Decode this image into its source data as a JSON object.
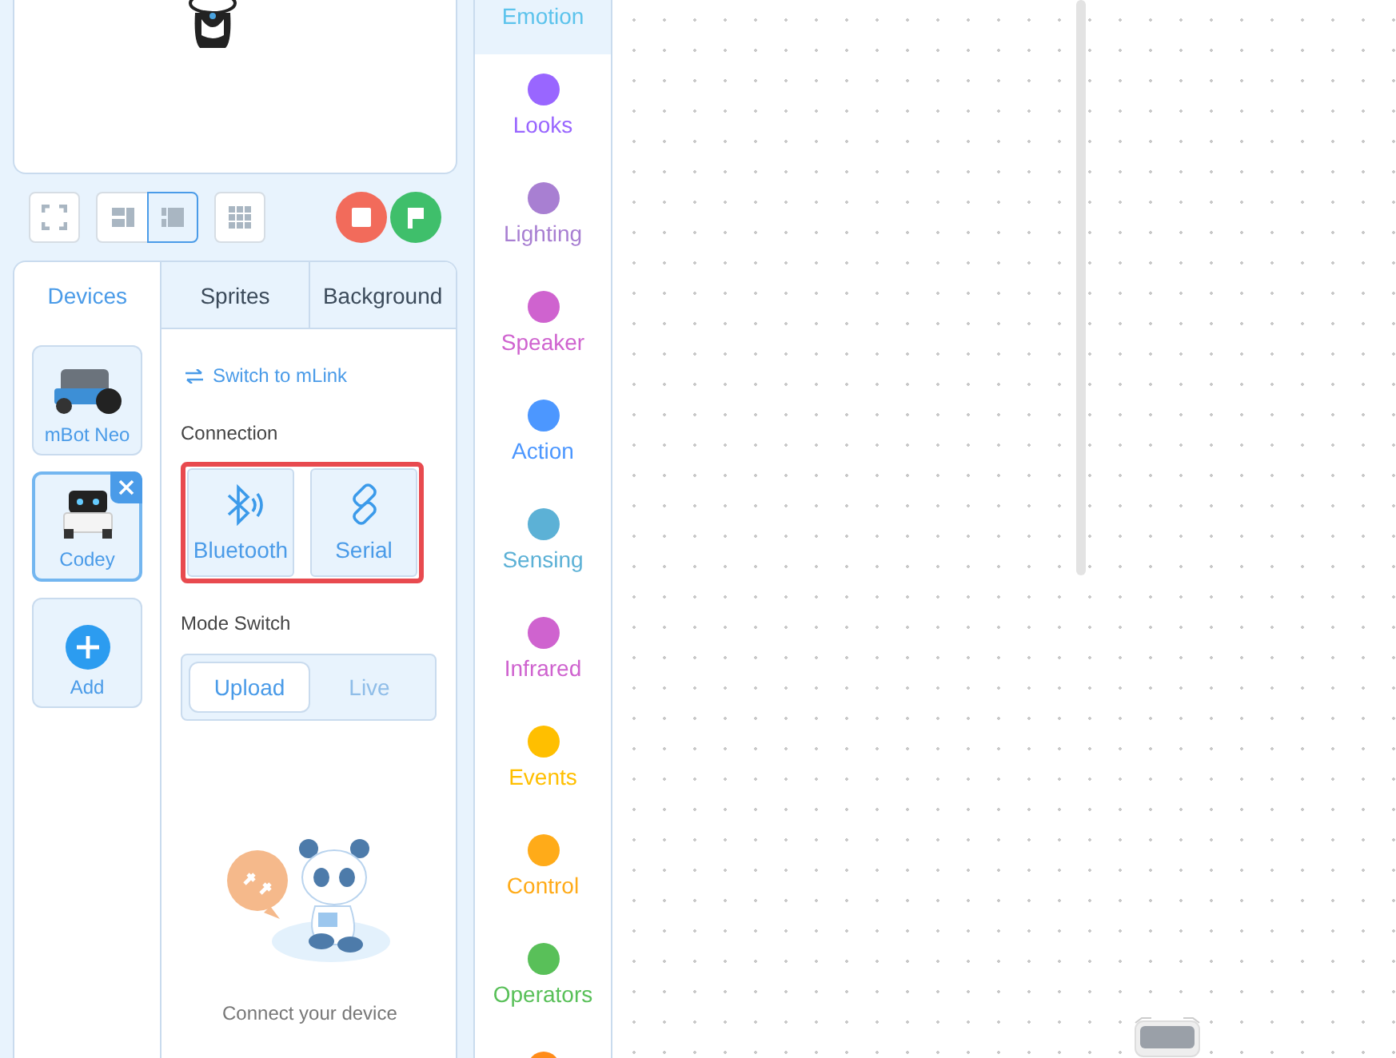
{
  "toolbar": {
    "layouts": [
      {
        "kind": "fullscreen",
        "selected": false
      },
      {
        "kind": "small-stage",
        "selected": false
      },
      {
        "kind": "large-stage",
        "selected": true
      },
      {
        "kind": "grid",
        "selected": false
      }
    ]
  },
  "tabs": [
    {
      "label": "Devices",
      "selected": true
    },
    {
      "label": "Sprites",
      "selected": false
    },
    {
      "label": "Background",
      "selected": false
    }
  ],
  "devices": [
    {
      "kind": "robot-car",
      "label": "mBot Neo",
      "selected": false
    },
    {
      "kind": "robot-codey",
      "label": "Codey",
      "selected": true
    },
    {
      "kind": "add",
      "label": "Add",
      "selected": false
    }
  ],
  "switch_link": "Switch to mLink",
  "connection": {
    "label": "Connection",
    "options": [
      {
        "kind": "bluetooth",
        "label": "Bluetooth"
      },
      {
        "kind": "serial",
        "label": "Serial"
      }
    ]
  },
  "mode_switch": {
    "label": "Mode Switch",
    "options": [
      {
        "label": "Upload",
        "selected": true
      },
      {
        "label": "Live",
        "selected": false
      }
    ]
  },
  "connect_hint": "Connect your device",
  "categories": [
    {
      "label": "Emotion",
      "color": "#5cc3ec",
      "selected": true
    },
    {
      "label": "Looks",
      "color": "#9966ff",
      "selected": false
    },
    {
      "label": "Lighting",
      "color": "#a87fd2",
      "selected": false
    },
    {
      "label": "Speaker",
      "color": "#cf63cf",
      "selected": false
    },
    {
      "label": "Action",
      "color": "#4c97ff",
      "selected": false
    },
    {
      "label": "Sensing",
      "color": "#5cb1d6",
      "selected": false
    },
    {
      "label": "Infrared",
      "color": "#cf63cf",
      "selected": false
    },
    {
      "label": "Events",
      "color": "#ffbf00",
      "selected": false
    },
    {
      "label": "Control",
      "color": "#ffab19",
      "selected": false
    },
    {
      "label": "Operators",
      "color": "#59c059",
      "selected": false
    },
    {
      "color": "#ff8c1a",
      "selected": false
    }
  ]
}
